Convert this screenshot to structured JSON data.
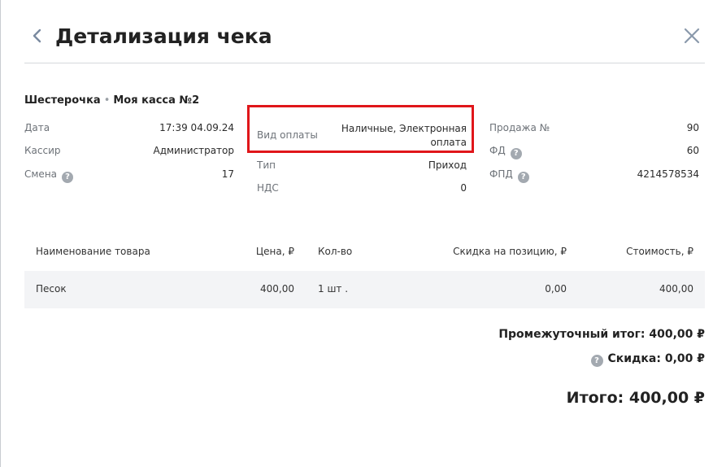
{
  "header": {
    "title": "Детализация чека",
    "back_icon": "chevron-left-icon",
    "close_icon": "close-icon"
  },
  "shop": {
    "name": "Шестерочка",
    "separator": "•",
    "register": "Моя касса №2"
  },
  "info": {
    "col1": [
      {
        "label": "Дата",
        "value": "17:39 04.09.24"
      },
      {
        "label": "Кассир",
        "value": "Администратор"
      },
      {
        "label": "Смена",
        "value": "17",
        "help": "?"
      }
    ],
    "col2": [
      {
        "label": "Вид оплаты",
        "value_line1": "Наличные, Электронная",
        "value_line2": "оплата"
      },
      {
        "label": "Тип",
        "value": "Приход"
      },
      {
        "label": "НДС",
        "value": "0"
      }
    ],
    "col3": [
      {
        "label": "Продажа №",
        "value": "90"
      },
      {
        "label": "ФД",
        "value": "60",
        "help": "?"
      },
      {
        "label": "ФПД",
        "value": "4214578534",
        "help": "?"
      }
    ]
  },
  "table": {
    "headers": [
      "Наименование товара",
      "Цена, ₽",
      "Кол-во",
      "Скидка на позицию, ₽",
      "Стоимость, ₽"
    ],
    "rows": [
      [
        "Песок",
        "400,00",
        "1 шт .",
        "0,00",
        "400,00"
      ]
    ]
  },
  "totals": {
    "subtotal_label": "Промежуточный итог:",
    "subtotal_value": "400,00 ₽",
    "discount_label": "Скидка:",
    "discount_value": "0,00 ₽",
    "discount_help": "?",
    "total_label": "Итого:",
    "total_value": "400,00 ₽"
  },
  "colors": {
    "highlight_border": "#e0161a",
    "row_background": "#f3f4f6",
    "help_icon": "#a3a9b0"
  }
}
